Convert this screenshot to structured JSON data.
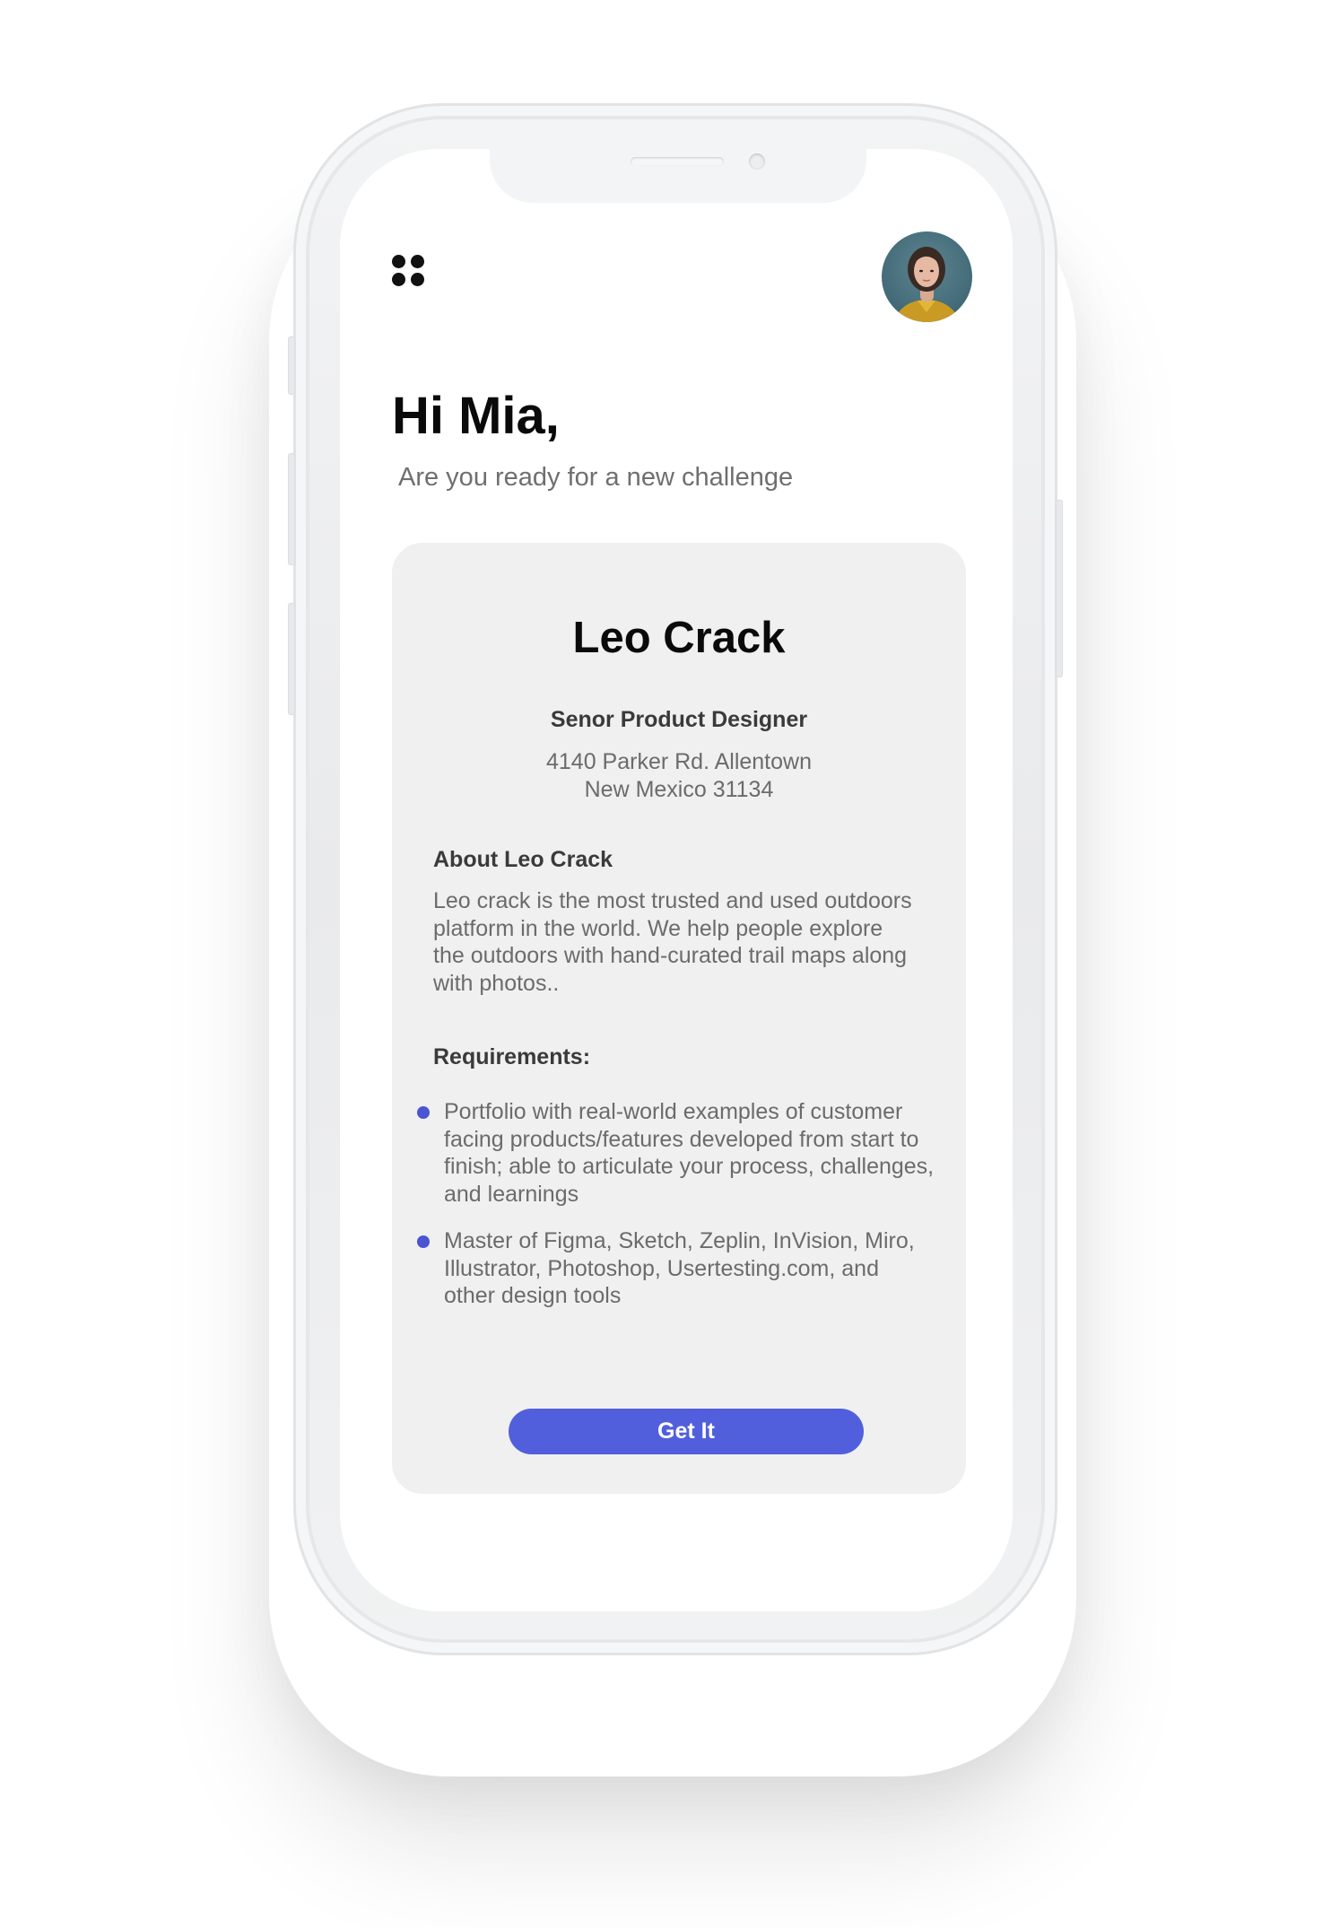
{
  "header": {
    "menu_icon": "grid-dots-icon",
    "avatar": "user-avatar"
  },
  "greeting": {
    "title": "Hi Mia,",
    "subtitle": "Are you ready for a new challenge"
  },
  "job_card": {
    "company": "Leo Crack",
    "role": "Senor Product Designer",
    "address_line1": "4140 Parker Rd. Allentown",
    "address_line2": "New Mexico 31134",
    "about_heading": "About Leo Crack",
    "about_text": "Leo crack is the most trusted and used outdoors platform in the world. We help people explore the outdoors with hand-curated trail maps along with photos..",
    "requirements_heading": "Requirements:",
    "requirements": [
      "Portfolio with real-world examples of customer facing products/features developed from start to finish; able to articulate your process, challenges, and learnings",
      "Master of Figma, Sketch, Zeplin, InVision, Miro, Illustrator, Photoshop, Usertesting.com, and other design tools"
    ],
    "cta_label": "Get It"
  },
  "colors": {
    "accent": "#525fdd",
    "bullet": "#4a55d2",
    "card_background": "#f0f0f1",
    "heading": "#0a0a0a",
    "body_text": "#6b6b6b"
  }
}
